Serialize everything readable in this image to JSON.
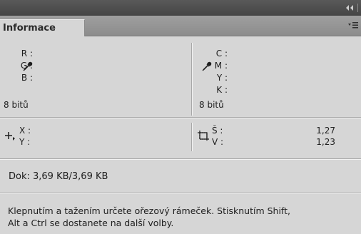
{
  "window": {
    "collapse_glyph": "◂◂"
  },
  "tab": {
    "label": "Informace"
  },
  "rgb": {
    "labels": [
      "R :",
      "G :",
      "B :"
    ],
    "bit_depth": "8 bitů"
  },
  "cmyk": {
    "labels": [
      "C :",
      "M :",
      "Y :",
      "K :"
    ],
    "bit_depth": "8 bitů"
  },
  "position": {
    "x_label": "X :",
    "y_label": "Y :"
  },
  "size": {
    "w_label": "Š :",
    "h_label": "V :",
    "w_value": "1,27",
    "h_value": "1,23"
  },
  "doc": {
    "text": "Dok: 3,69 KB/3,69 KB"
  },
  "hint": {
    "line1": "Klepnutím a tažením určete ořezový rámeček. Stisknutím Shift,",
    "line2": "Alt a Ctrl se dostanete na další volby."
  },
  "icons": {
    "collapse": "double-chevron-left-icon",
    "panel_menu": "panel-menu-icon",
    "eyedropper_rgb": "eyedropper-icon",
    "eyedropper_cmyk": "eyedropper-icon",
    "crosshair": "crosshair-position-icon",
    "selection": "selection-size-icon"
  },
  "colors": {
    "titlebar": "#4e4e4e",
    "panel_bg": "#d6d6d6",
    "tabstrip": "#969696"
  }
}
